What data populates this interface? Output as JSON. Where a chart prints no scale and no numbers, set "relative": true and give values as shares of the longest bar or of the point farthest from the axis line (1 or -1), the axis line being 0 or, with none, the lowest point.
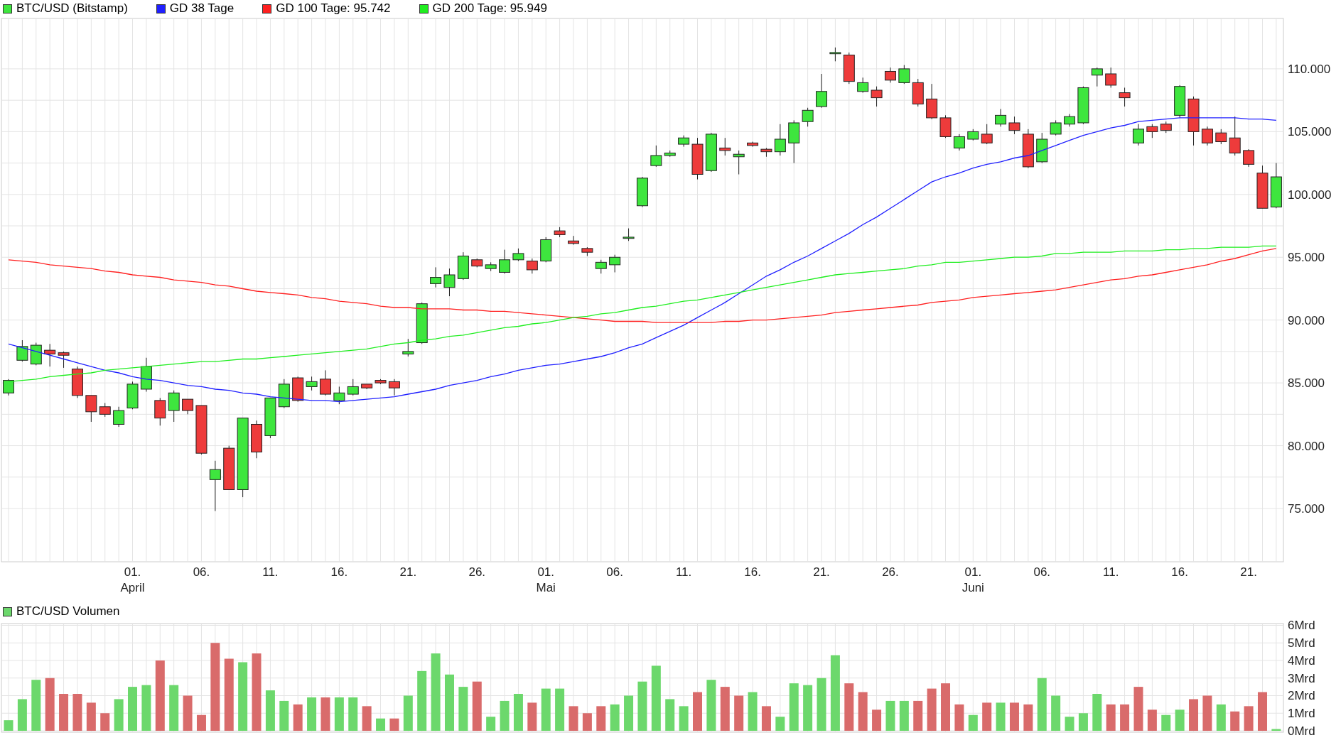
{
  "price_chart": {
    "chart_data": {
      "type": "candlestick",
      "title": "BTC/USD (Bitstamp)",
      "grid": true,
      "ylim": [
        70760,
        114010
      ],
      "yticks": [
        {
          "value": 75000,
          "label": "75.000"
        },
        {
          "value": 80000,
          "label": "80.000"
        },
        {
          "value": 85000,
          "label": "85.000"
        },
        {
          "value": 90000,
          "label": "90.000"
        },
        {
          "value": 95000,
          "label": "95.000"
        },
        {
          "value": 100000,
          "label": "100.000"
        },
        {
          "value": 105000,
          "label": "105.000"
        },
        {
          "value": 110000,
          "label": "110.000"
        }
      ],
      "categories": [
        null,
        null,
        null,
        null,
        null,
        null,
        null,
        null,
        null,
        "01.\nApril",
        null,
        null,
        null,
        null,
        "06.",
        null,
        null,
        null,
        null,
        "11.",
        null,
        null,
        null,
        null,
        "16.",
        null,
        null,
        null,
        null,
        "21.",
        null,
        null,
        null,
        null,
        "26.",
        null,
        null,
        null,
        null,
        "01.\nMai",
        null,
        null,
        null,
        null,
        "06.",
        null,
        null,
        null,
        null,
        "11.",
        null,
        null,
        null,
        null,
        "16.",
        null,
        null,
        null,
        null,
        "21.",
        null,
        null,
        null,
        null,
        "26.",
        null,
        null,
        null,
        null,
        null,
        "01.\nJuni",
        null,
        null,
        null,
        null,
        "06.",
        null,
        null,
        null,
        null,
        "11.",
        null,
        null,
        null,
        null,
        "16.",
        null,
        null,
        null,
        null,
        "21.",
        null,
        null
      ],
      "ohlc": [
        [
          84200,
          85300,
          84000,
          85200
        ],
        [
          86800,
          88400,
          86700,
          87900
        ],
        [
          86500,
          88200,
          86400,
          88000
        ],
        [
          87600,
          88100,
          86300,
          87300
        ],
        [
          87400,
          87500,
          86200,
          87200
        ],
        [
          86100,
          86300,
          83800,
          84000
        ],
        [
          84000,
          84000,
          81900,
          82700
        ],
        [
          83100,
          83400,
          82300,
          82500
        ],
        [
          81700,
          83100,
          81500,
          82800
        ],
        [
          83000,
          85100,
          82900,
          84900
        ],
        [
          84500,
          87000,
          84300,
          86300
        ],
        [
          83600,
          83800,
          81600,
          82200
        ],
        [
          82800,
          84400,
          81900,
          84200
        ],
        [
          83700,
          83700,
          82500,
          82800
        ],
        [
          83200,
          83200,
          79300,
          79400
        ],
        [
          77300,
          78800,
          74800,
          78100
        ],
        [
          79800,
          80000,
          76500,
          76500
        ],
        [
          76500,
          82200,
          75900,
          82200
        ],
        [
          81700,
          82000,
          79000,
          79500
        ],
        [
          80800,
          83800,
          80600,
          83800
        ],
        [
          83100,
          85300,
          83000,
          84900
        ],
        [
          85400,
          85500,
          83500,
          83600
        ],
        [
          84700,
          85500,
          84400,
          85100
        ],
        [
          85300,
          86000,
          84000,
          84100
        ],
        [
          83600,
          84700,
          83300,
          84200
        ],
        [
          84100,
          85300,
          84000,
          84700
        ],
        [
          84900,
          84900,
          84500,
          84600
        ],
        [
          85200,
          85300,
          84900,
          85000
        ],
        [
          85100,
          85300,
          84000,
          84600
        ],
        [
          87300,
          88500,
          87100,
          87500
        ],
        [
          88200,
          91400,
          88100,
          91300
        ],
        [
          92900,
          94200,
          92600,
          93400
        ],
        [
          92600,
          94100,
          91900,
          93600
        ],
        [
          93300,
          95400,
          93200,
          95100
        ],
        [
          94800,
          94900,
          94200,
          94300
        ],
        [
          94100,
          94600,
          93900,
          94400
        ],
        [
          93800,
          95600,
          93700,
          94800
        ],
        [
          94800,
          95700,
          94700,
          95300
        ],
        [
          94700,
          94900,
          93700,
          94000
        ],
        [
          94700,
          96600,
          94600,
          96400
        ],
        [
          97100,
          97400,
          96600,
          96800
        ],
        [
          96300,
          96700,
          96000,
          96100
        ],
        [
          95700,
          95800,
          95100,
          95400
        ],
        [
          94100,
          94800,
          93700,
          94600
        ],
        [
          94400,
          95200,
          93800,
          95000
        ],
        [
          96500,
          97300,
          96300,
          96600
        ],
        [
          99100,
          101400,
          99000,
          101300
        ],
        [
          102300,
          103900,
          102200,
          103100
        ],
        [
          103100,
          103500,
          103000,
          103300
        ],
        [
          104000,
          104700,
          103800,
          104500
        ],
        [
          104000,
          104500,
          101200,
          101600
        ],
        [
          101900,
          104900,
          101800,
          104800
        ],
        [
          103700,
          104500,
          103100,
          103500
        ],
        [
          103000,
          103500,
          101600,
          103200
        ],
        [
          104100,
          104200,
          103800,
          103900
        ],
        [
          103600,
          103700,
          103000,
          103400
        ],
        [
          103400,
          105600,
          103100,
          104400
        ],
        [
          104100,
          105900,
          102500,
          105700
        ],
        [
          105800,
          106900,
          105400,
          106700
        ],
        [
          107000,
          109600,
          106900,
          108200
        ],
        [
          111200,
          111700,
          110600,
          111300
        ],
        [
          111100,
          111300,
          108800,
          109000
        ],
        [
          108200,
          109300,
          108100,
          108900
        ],
        [
          108300,
          108600,
          107000,
          107700
        ],
        [
          109800,
          110100,
          108900,
          109100
        ],
        [
          108900,
          110300,
          108800,
          110000
        ],
        [
          108900,
          109200,
          107000,
          107200
        ],
        [
          107600,
          108800,
          106000,
          106100
        ],
        [
          106100,
          106300,
          104500,
          104600
        ],
        [
          103700,
          104800,
          103500,
          104600
        ],
        [
          104400,
          105200,
          104300,
          105000
        ],
        [
          104800,
          105600,
          104000,
          104100
        ],
        [
          105600,
          106800,
          105400,
          106300
        ],
        [
          105700,
          106200,
          104800,
          105100
        ],
        [
          104800,
          105200,
          102100,
          102200
        ],
        [
          102600,
          104900,
          102500,
          104400
        ],
        [
          104800,
          105900,
          104700,
          105700
        ],
        [
          105600,
          106400,
          105400,
          106200
        ],
        [
          105700,
          108600,
          105600,
          108500
        ],
        [
          109500,
          110100,
          108600,
          110000
        ],
        [
          109600,
          110100,
          108500,
          108700
        ],
        [
          108100,
          108500,
          107000,
          107700
        ],
        [
          104100,
          105600,
          103900,
          105200
        ],
        [
          105400,
          105600,
          104500,
          105000
        ],
        [
          105600,
          105800,
          104900,
          105100
        ],
        [
          106300,
          108700,
          106100,
          108600
        ],
        [
          107600,
          107800,
          103900,
          105000
        ],
        [
          105200,
          105400,
          103900,
          104100
        ],
        [
          104900,
          105200,
          104000,
          104200
        ],
        [
          104500,
          106200,
          103100,
          103300
        ],
        [
          103500,
          103600,
          102200,
          102400
        ],
        [
          101700,
          102300,
          98900,
          98900
        ],
        [
          99000,
          102500,
          98900,
          101400
        ]
      ]
    }
  },
  "average_lines": {
    "chart_data": {
      "type": "line",
      "relative": true,
      "ylim": [
        70760,
        114010
      ],
      "series": [
        {
          "name": "GD 38 Tage",
          "color": "#2020ff",
          "values": [
            88100,
            87800,
            87500,
            87200,
            86900,
            86600,
            86300,
            86000,
            85800,
            85500,
            85300,
            85200,
            85000,
            84800,
            84700,
            84500,
            84400,
            84200,
            84100,
            83900,
            83800,
            83700,
            83600,
            83600,
            83500,
            83600,
            83700,
            83800,
            83900,
            84100,
            84300,
            84500,
            84800,
            85000,
            85200,
            85500,
            85700,
            86000,
            86200,
            86400,
            86500,
            86700,
            86900,
            87100,
            87400,
            87800,
            88100,
            88600,
            89100,
            89600,
            90200,
            90800,
            91400,
            92100,
            92800,
            93500,
            94000,
            94600,
            95100,
            95700,
            96300,
            96900,
            97600,
            98200,
            98900,
            99600,
            100300,
            101000,
            101400,
            101700,
            102100,
            102400,
            102600,
            102900,
            103100,
            103500,
            103900,
            104300,
            104700,
            105000,
            105300,
            105500,
            105800,
            105900,
            106000,
            106100,
            106100,
            106100,
            106100,
            106100,
            106000,
            106000,
            105900
          ]
        },
        {
          "name": "GD 100 Tage: 95.742",
          "color": "#ff2020",
          "values": [
            94800,
            94700,
            94600,
            94400,
            94300,
            94200,
            94100,
            93900,
            93800,
            93600,
            93500,
            93400,
            93200,
            93100,
            93000,
            92800,
            92700,
            92500,
            92300,
            92200,
            92100,
            92000,
            91800,
            91700,
            91500,
            91400,
            91300,
            91100,
            91000,
            91000,
            90900,
            90900,
            90900,
            90800,
            90800,
            90700,
            90700,
            90600,
            90500,
            90400,
            90300,
            90200,
            90100,
            90000,
            89900,
            89900,
            89900,
            89800,
            89800,
            89800,
            89800,
            89800,
            89900,
            89900,
            90000,
            90000,
            90100,
            90200,
            90300,
            90400,
            90600,
            90700,
            90800,
            90900,
            91000,
            91100,
            91200,
            91400,
            91500,
            91600,
            91800,
            91900,
            92000,
            92100,
            92200,
            92300,
            92400,
            92600,
            92800,
            93000,
            93200,
            93300,
            93500,
            93600,
            93800,
            94000,
            94200,
            94400,
            94700,
            94900,
            95200,
            95500,
            95700
          ]
        },
        {
          "name": "GD 200 Tage: 95.949",
          "color": "#20ee20",
          "values": [
            85100,
            85200,
            85300,
            85500,
            85600,
            85700,
            85800,
            86000,
            86100,
            86200,
            86300,
            86400,
            86500,
            86600,
            86700,
            86700,
            86800,
            86900,
            86900,
            87000,
            87100,
            87200,
            87300,
            87400,
            87500,
            87600,
            87700,
            87900,
            88100,
            88200,
            88400,
            88500,
            88700,
            88800,
            89000,
            89200,
            89400,
            89500,
            89700,
            89800,
            90000,
            90200,
            90300,
            90500,
            90600,
            90800,
            91000,
            91100,
            91300,
            91500,
            91600,
            91800,
            92000,
            92200,
            92400,
            92600,
            92800,
            93000,
            93200,
            93400,
            93600,
            93700,
            93800,
            93900,
            94000,
            94100,
            94300,
            94400,
            94600,
            94600,
            94700,
            94800,
            94900,
            95000,
            95000,
            95100,
            95300,
            95300,
            95400,
            95400,
            95400,
            95500,
            95500,
            95500,
            95600,
            95600,
            95700,
            95700,
            95800,
            95800,
            95800,
            95900,
            95900
          ]
        }
      ]
    }
  },
  "volume_chart": {
    "chart_data": {
      "type": "bar",
      "grid": true,
      "ylim": [
        0,
        6.1
      ],
      "yticks": [
        {
          "value": 0,
          "label": "0Mrd"
        },
        {
          "value": 1,
          "label": "1Mrd"
        },
        {
          "value": 2,
          "label": "2Mrd"
        },
        {
          "value": 3,
          "label": "3Mrd"
        },
        {
          "value": 4,
          "label": "4Mrd"
        },
        {
          "value": 5,
          "label": "5Mrd"
        },
        {
          "value": 6,
          "label": "6Mrd"
        }
      ],
      "series": [
        {
          "name": "BTC/USD Volumen",
          "color": "#6cd86c",
          "values": [
            0.6,
            1.8,
            2.9,
            null,
            null,
            null,
            null,
            null,
            1.8,
            2.5,
            2.6,
            null,
            2.6,
            null,
            null,
            null,
            null,
            3.9,
            null,
            2.3,
            1.7,
            null,
            1.9,
            null,
            1.9,
            1.9,
            null,
            0.7,
            null,
            2.0,
            3.4,
            4.4,
            3.2,
            2.5,
            null,
            0.8,
            1.7,
            2.1,
            null,
            2.4,
            2.4,
            null,
            null,
            null,
            1.5,
            2.0,
            2.8,
            3.7,
            1.8,
            1.4,
            null,
            2.9,
            null,
            null,
            2.2,
            null,
            0.8,
            2.7,
            2.6,
            3.0,
            4.3,
            null,
            null,
            null,
            1.7,
            1.7,
            null,
            null,
            null,
            null,
            0.9,
            null,
            1.6,
            null,
            null,
            3.0,
            2.0,
            0.8,
            1.0,
            2.1,
            null,
            null,
            null,
            null,
            0.9,
            1.2,
            null,
            null,
            1.5,
            null,
            null,
            null,
            0.1
          ]
        },
        {
          "color": "#d96b6b",
          "values": [
            null,
            null,
            null,
            3.0,
            2.1,
            2.1,
            1.6,
            1.0,
            null,
            null,
            null,
            4.0,
            null,
            2.0,
            0.9,
            5.0,
            4.1,
            null,
            4.4,
            null,
            null,
            1.5,
            null,
            1.9,
            null,
            null,
            1.4,
            null,
            0.7,
            null,
            null,
            null,
            null,
            null,
            2.8,
            null,
            null,
            null,
            1.6,
            null,
            null,
            1.4,
            1.0,
            1.4,
            null,
            null,
            null,
            null,
            null,
            null,
            2.2,
            null,
            2.5,
            2.0,
            null,
            1.4,
            null,
            null,
            null,
            null,
            null,
            2.7,
            2.2,
            1.2,
            null,
            null,
            1.7,
            2.4,
            2.7,
            1.5,
            null,
            1.6,
            null,
            1.6,
            1.5,
            null,
            null,
            null,
            null,
            null,
            1.5,
            1.5,
            2.5,
            1.2,
            null,
            null,
            1.8,
            2.0,
            null,
            1.1,
            1.4,
            2.2,
            null
          ]
        }
      ]
    }
  }
}
